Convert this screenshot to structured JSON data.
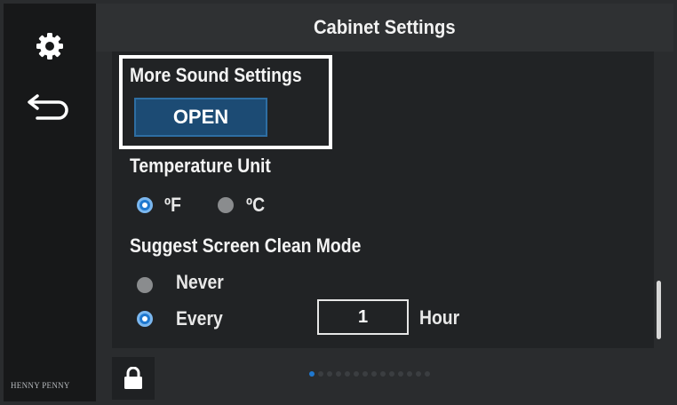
{
  "header": {
    "title": "Cabinet Settings"
  },
  "sidebar": {
    "settings_icon": "gear-icon",
    "back_icon": "back-arrow-icon",
    "brand": "HENNY PENNY"
  },
  "sound": {
    "label": "More Sound Settings",
    "open_label": "OPEN"
  },
  "temperature": {
    "label": "Temperature Unit",
    "fahrenheit": "ºF",
    "celsius": "ºC",
    "selected": "ºF"
  },
  "clean_mode": {
    "label": "Suggest Screen Clean Mode",
    "never": "Never",
    "every": "Every",
    "selected": "Every",
    "hours_value": "1",
    "hours_unit": "Hour"
  },
  "pager": {
    "total": 14,
    "current": 1
  },
  "colors": {
    "accent": "#1f78cf",
    "button_bg": "#1c4b74"
  }
}
